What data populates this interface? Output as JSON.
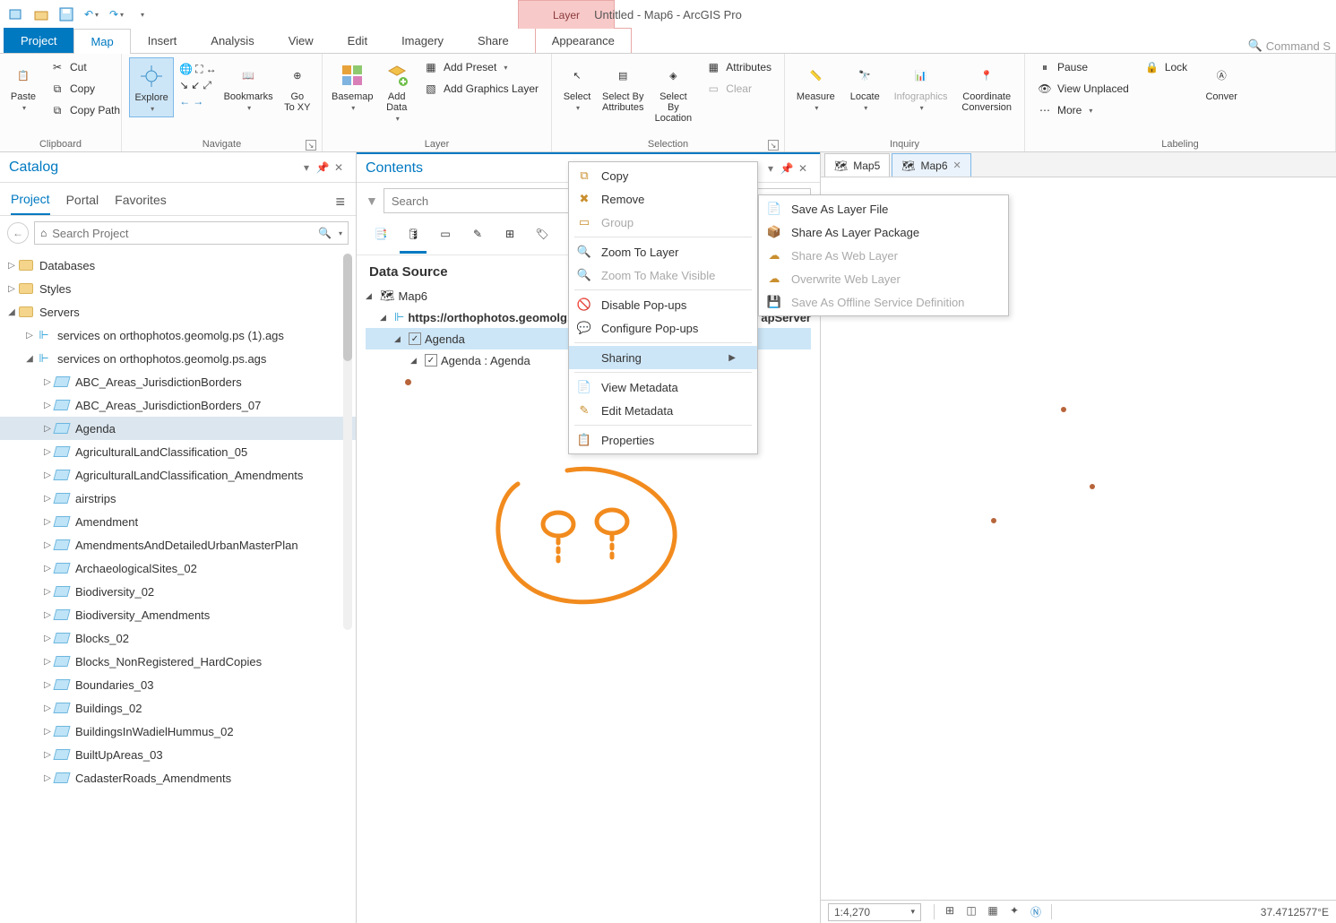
{
  "app_title": "Untitled - Map6 - ArcGIS Pro",
  "context_tab_group": "Layer",
  "search_hint": "Command S",
  "ribbon_tabs": {
    "file": "Project",
    "map": "Map",
    "insert": "Insert",
    "analysis": "Analysis",
    "view": "View",
    "edit": "Edit",
    "imagery": "Imagery",
    "share": "Share",
    "appearance": "Appearance"
  },
  "ribbon": {
    "clipboard": {
      "label": "Clipboard",
      "paste": "Paste",
      "cut": "Cut",
      "copy": "Copy",
      "copy_path": "Copy Path"
    },
    "navigate": {
      "label": "Navigate",
      "explore": "Explore",
      "bookmarks": "Bookmarks",
      "goto": "Go\nTo XY"
    },
    "layer": {
      "label": "Layer",
      "basemap": "Basemap",
      "add_data": "Add\nData",
      "add_preset": "Add Preset",
      "add_graphics": "Add Graphics Layer"
    },
    "selection": {
      "label": "Selection",
      "select": "Select",
      "sel_attr": "Select By\nAttributes",
      "sel_loc": "Select By\nLocation",
      "attributes": "Attributes",
      "clear": "Clear"
    },
    "inquiry": {
      "label": "Inquiry",
      "measure": "Measure",
      "locate": "Locate",
      "infographics": "Infographics",
      "coord": "Coordinate\nConversion"
    },
    "labeling": {
      "label": "Labeling",
      "pause": "Pause",
      "lock": "Lock",
      "unplaced": "View Unplaced",
      "more": "More",
      "convert": "Conver"
    }
  },
  "catalog": {
    "title": "Catalog",
    "tabs": {
      "project": "Project",
      "portal": "Portal",
      "favorites": "Favorites"
    },
    "search_placeholder": "Search Project",
    "nodes": {
      "databases": "Databases",
      "styles": "Styles",
      "servers": "Servers",
      "svc1": "services on orthophotos.geomolg.ps (1).ags",
      "svc2": "services on orthophotos.geomolg.ps.ags"
    },
    "layers": [
      "ABC_Areas_JurisdictionBorders",
      "ABC_Areas_JurisdictionBorders_07",
      "Agenda",
      "AgriculturalLandClassification_05",
      "AgriculturalLandClassification_Amendments",
      "airstrips",
      "Amendment",
      "AmendmentsAndDetailedUrbanMasterPlan",
      "ArchaeologicalSites_02",
      "Biodiversity_02",
      "Biodiversity_Amendments",
      "Blocks_02",
      "Blocks_NonRegistered_HardCopies",
      "Boundaries_03",
      "Buildings_02",
      "BuildingsInWadielHummus_02",
      "BuiltUpAreas_03",
      "CadasterRoads_Amendments"
    ]
  },
  "contents": {
    "title": "Contents",
    "search_placeholder": "Search",
    "section": "Data Source",
    "map_name": "Map6",
    "service_url": "https://orthophotos.geomolg.p",
    "service_suffix": "apServer",
    "layer": "Agenda",
    "sublayer": "Agenda : Agenda"
  },
  "ctx_menu": {
    "copy": "Copy",
    "remove": "Remove",
    "group": "Group",
    "zoom_layer": "Zoom To Layer",
    "zoom_visible": "Zoom To Make Visible",
    "disable_popups": "Disable Pop-ups",
    "config_popups": "Configure Pop-ups",
    "sharing": "Sharing",
    "view_meta": "View Metadata",
    "edit_meta": "Edit Metadata",
    "properties": "Properties"
  },
  "share_menu": {
    "save_lyr": "Save As Layer File",
    "share_pkg": "Share As Layer Package",
    "share_web": "Share As Web Layer",
    "overwrite": "Overwrite Web Layer",
    "save_offline": "Save As Offline Service Definition"
  },
  "map_tabs": {
    "map5": "Map5",
    "map6": "Map6"
  },
  "status": {
    "scale": "1:4,270",
    "coord": "37.4712577°E"
  }
}
